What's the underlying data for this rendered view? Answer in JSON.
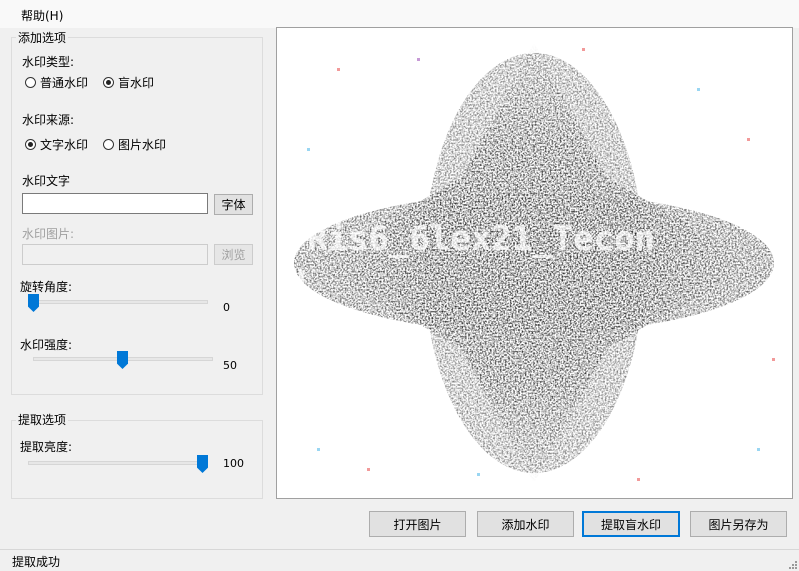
{
  "menu": {
    "help": "帮助(H)"
  },
  "add_options": {
    "title": "添加选项",
    "type_label": "水印类型:",
    "type_options": [
      {
        "label": "普通水印",
        "selected": false
      },
      {
        "label": "盲水印",
        "selected": true
      }
    ],
    "source_label": "水印来源:",
    "source_options": [
      {
        "label": "文字水印",
        "selected": true
      },
      {
        "label": "图片水印",
        "selected": false
      }
    ],
    "text_label": "水印文字",
    "text_value": "",
    "font_button": "字体",
    "image_label": "水印图片:",
    "image_value": "",
    "browse_button": "浏览",
    "rotation_label": "旋转角度:",
    "rotation_value": "0",
    "strength_label": "水印强度:",
    "strength_value": "50"
  },
  "extract_options": {
    "title": "提取选项",
    "brightness_label": "提取亮度:",
    "brightness_value": "100"
  },
  "actions": {
    "open": "打开图片",
    "add": "添加水印",
    "extract": "提取盲水印",
    "save_as": "图片另存为"
  },
  "preview": {
    "text": "Ris6_6lex21_Tecon"
  },
  "status": {
    "text": "提取成功"
  }
}
